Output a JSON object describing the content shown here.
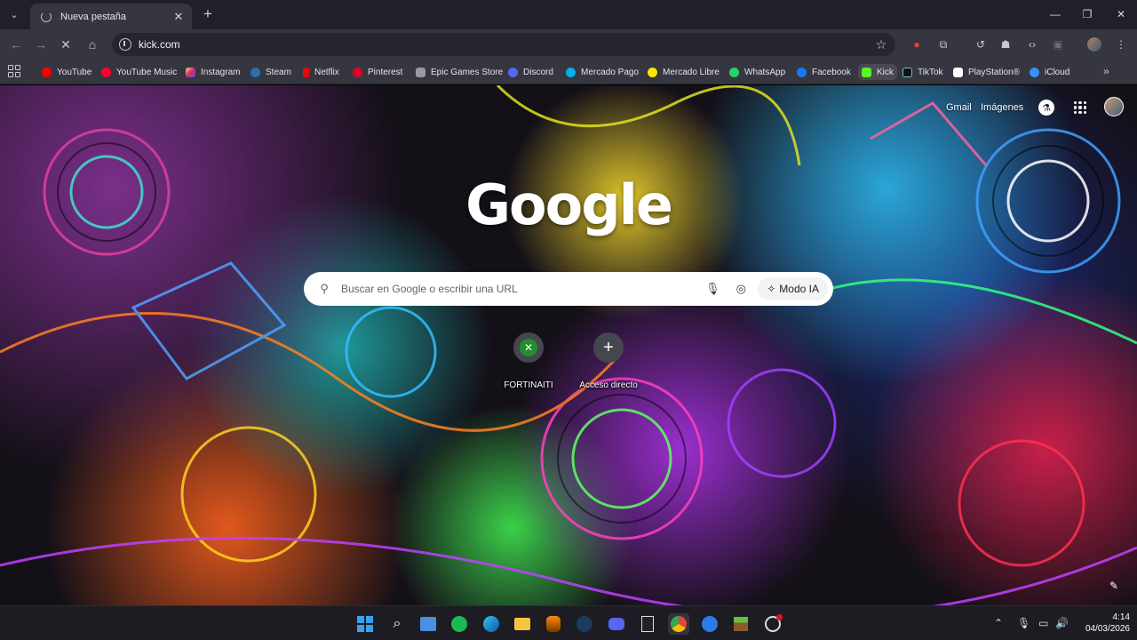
{
  "browser": {
    "tab": {
      "title": "Nueva pestaña"
    },
    "url": "kick.com",
    "bookmarks": [
      {
        "label": "YouTube",
        "color": "#ff0000"
      },
      {
        "label": "YouTube Music",
        "color": "#ff0033"
      },
      {
        "label": "Instagram",
        "color": "#d6249f"
      },
      {
        "label": "Steam",
        "color": "#2a6fb0"
      },
      {
        "label": "Netflix",
        "color": "#e50914"
      },
      {
        "label": "Pinterest",
        "color": "#e60023"
      },
      {
        "label": "Epic Games Store",
        "color": "#9a9aa0"
      },
      {
        "label": "Discord",
        "color": "#5865f2"
      },
      {
        "label": "Mercado Pago",
        "color": "#00b1ea"
      },
      {
        "label": "Mercado Libre",
        "color": "#ffe600"
      },
      {
        "label": "WhatsApp",
        "color": "#25d366"
      },
      {
        "label": "Facebook",
        "color": "#1877f2"
      },
      {
        "label": "Kick",
        "color": "#53fc18"
      },
      {
        "label": "TikTok",
        "color": "#ffffff"
      },
      {
        "label": "PlayStation®",
        "color": "#ffffff"
      },
      {
        "label": "iCloud",
        "color": "#3693f3"
      }
    ]
  },
  "newtab": {
    "top_links": {
      "gmail": "Gmail",
      "images": "Imágenes"
    },
    "logo": "Google",
    "search": {
      "placeholder": "Buscar en Google o escribir una URL",
      "ai_mode": "Modo IA"
    },
    "shortcuts": [
      {
        "label": "FORTINAITI",
        "icon": "xbox-icon"
      },
      {
        "label": "Acceso directo",
        "icon": "plus-icon"
      }
    ]
  },
  "taskbar": {
    "time": "4:14",
    "date": "04/03/2026"
  },
  "colors": {
    "tabstrip": "#20202a",
    "toolbar": "#35363f",
    "accent_blue": "#3aa0f0"
  }
}
